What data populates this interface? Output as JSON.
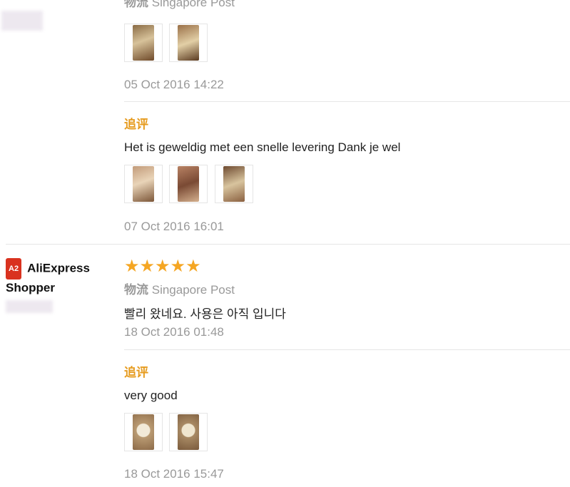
{
  "reviews": [
    {
      "shipping_label": "物流",
      "shipping_method": "Singapore Post",
      "date": "05 Oct 2016 14:22",
      "followup": {
        "label": "追评",
        "text": "Het is geweldig met een snelle levering Dank je wel",
        "date": "07 Oct 2016 16:01"
      }
    },
    {
      "user": {
        "badge": "A2",
        "name": "AliExpress Shopper"
      },
      "rating": 5,
      "stars": "★★★★★",
      "shipping_label": "物流",
      "shipping_method": "Singapore Post",
      "text": "빨리 왔네요. 사용은 아직 입니다",
      "date": "18 Oct 2016 01:48",
      "followup": {
        "label": "追评",
        "text": "very good",
        "date": "18 Oct 2016 15:47"
      }
    }
  ],
  "colors": {
    "accent": "#e69b1e",
    "star": "#f5a623",
    "badge": "#d9321f"
  }
}
